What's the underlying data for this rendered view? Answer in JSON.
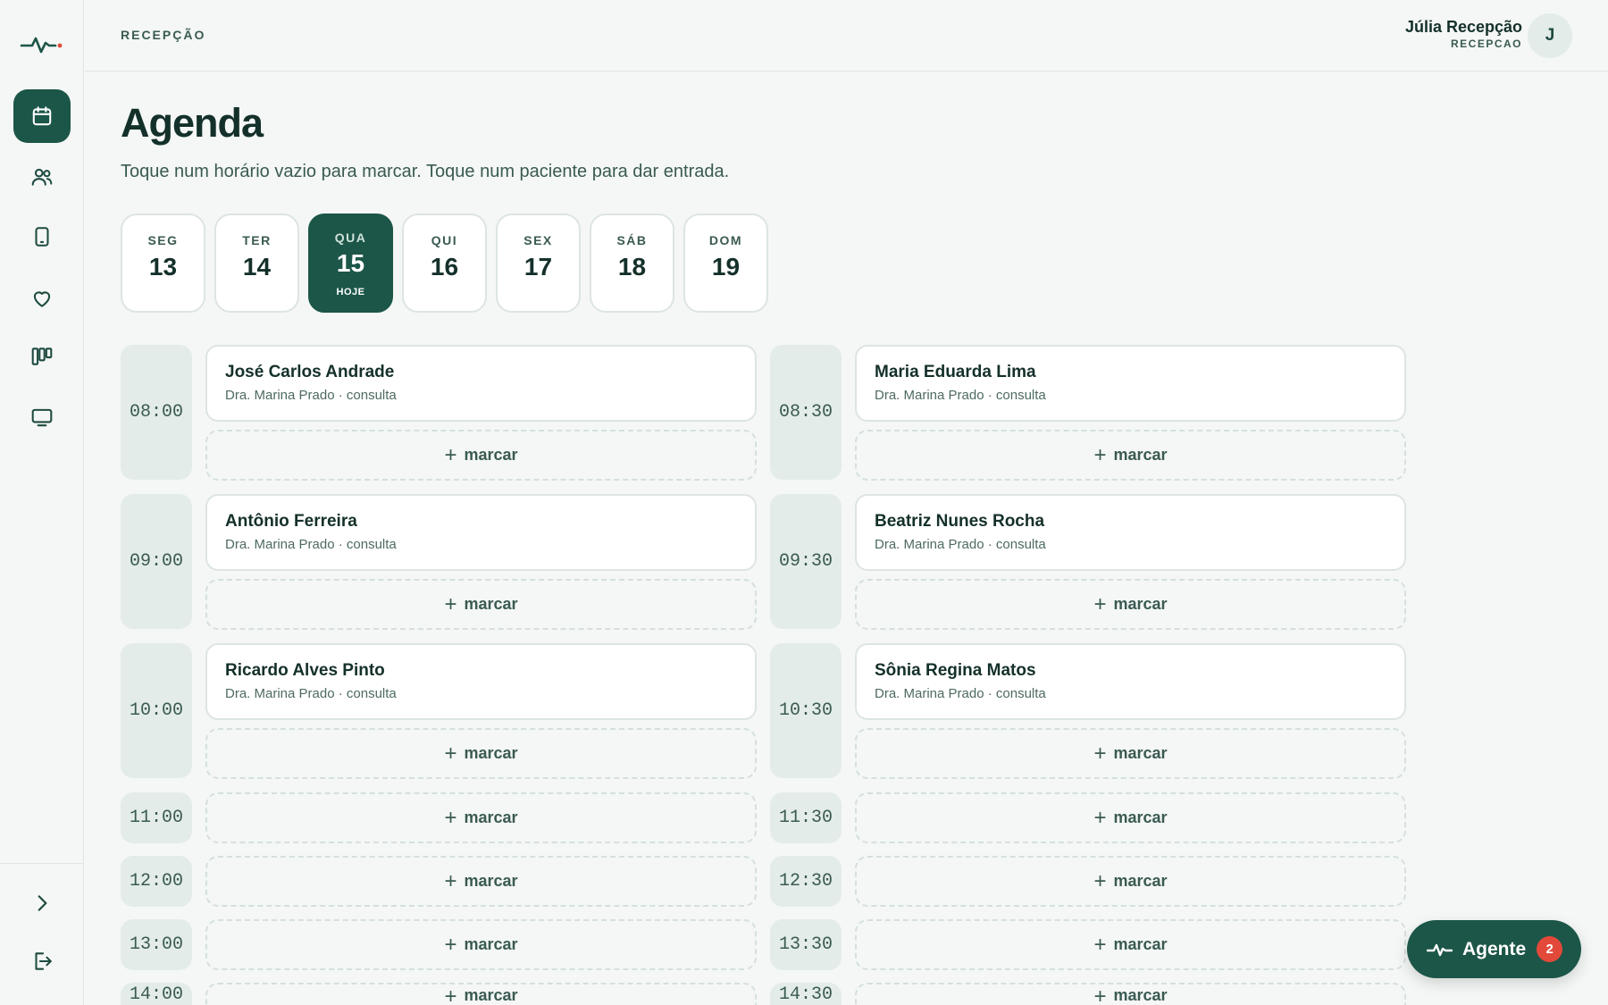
{
  "header": {
    "section": "RECEPÇÃO",
    "user_name": "Júlia Recepção",
    "user_role": "RECEPCAO",
    "avatar_initial": "J"
  },
  "page": {
    "title": "Agenda",
    "subtitle": "Toque num horário vazio para marcar. Toque num paciente para dar entrada."
  },
  "sidebar": {
    "items": [
      {
        "icon": "calendar-icon",
        "active": true
      },
      {
        "icon": "users-icon"
      },
      {
        "icon": "tablet-icon"
      },
      {
        "icon": "heart-icon"
      },
      {
        "icon": "kanban-icon"
      },
      {
        "icon": "monitor-icon"
      }
    ],
    "bottom": [
      {
        "icon": "chevron-right-icon"
      },
      {
        "icon": "logout-icon"
      }
    ]
  },
  "days": [
    {
      "name": "SEG",
      "num": "13"
    },
    {
      "name": "TER",
      "num": "14"
    },
    {
      "name": "QUA",
      "num": "15",
      "tag": "HOJE"
    },
    {
      "name": "QUI",
      "num": "16"
    },
    {
      "name": "SEX",
      "num": "17"
    },
    {
      "name": "SÁB",
      "num": "18"
    },
    {
      "name": "DOM",
      "num": "19"
    }
  ],
  "slots": {
    "book_label": "marcar",
    "left": [
      {
        "time": "08:00",
        "patient": "José Carlos Andrade",
        "info": "Dra. Marina Prado · consulta"
      },
      {
        "time": "09:00",
        "patient": "Antônio Ferreira",
        "info": "Dra. Marina Prado · consulta"
      },
      {
        "time": "10:00",
        "patient": "Ricardo Alves Pinto",
        "info": "Dra. Marina Prado · consulta"
      },
      {
        "time": "11:00"
      },
      {
        "time": "12:00"
      },
      {
        "time": "13:00"
      },
      {
        "time": "14:00"
      }
    ],
    "right": [
      {
        "time": "08:30",
        "patient": "Maria Eduarda Lima",
        "info": "Dra. Marina Prado · consulta"
      },
      {
        "time": "09:30",
        "patient": "Beatriz Nunes Rocha",
        "info": "Dra. Marina Prado · consulta"
      },
      {
        "time": "10:30",
        "patient": "Sônia Regina Matos",
        "info": "Dra. Marina Prado · consulta"
      },
      {
        "time": "11:30"
      },
      {
        "time": "12:30"
      },
      {
        "time": "13:30"
      },
      {
        "time": "14:30"
      }
    ]
  },
  "agent": {
    "label": "Agente",
    "badge": "2"
  },
  "colors": {
    "primary": "#1c5648",
    "badge": "#e2493a",
    "background": "#f4f7f5"
  }
}
